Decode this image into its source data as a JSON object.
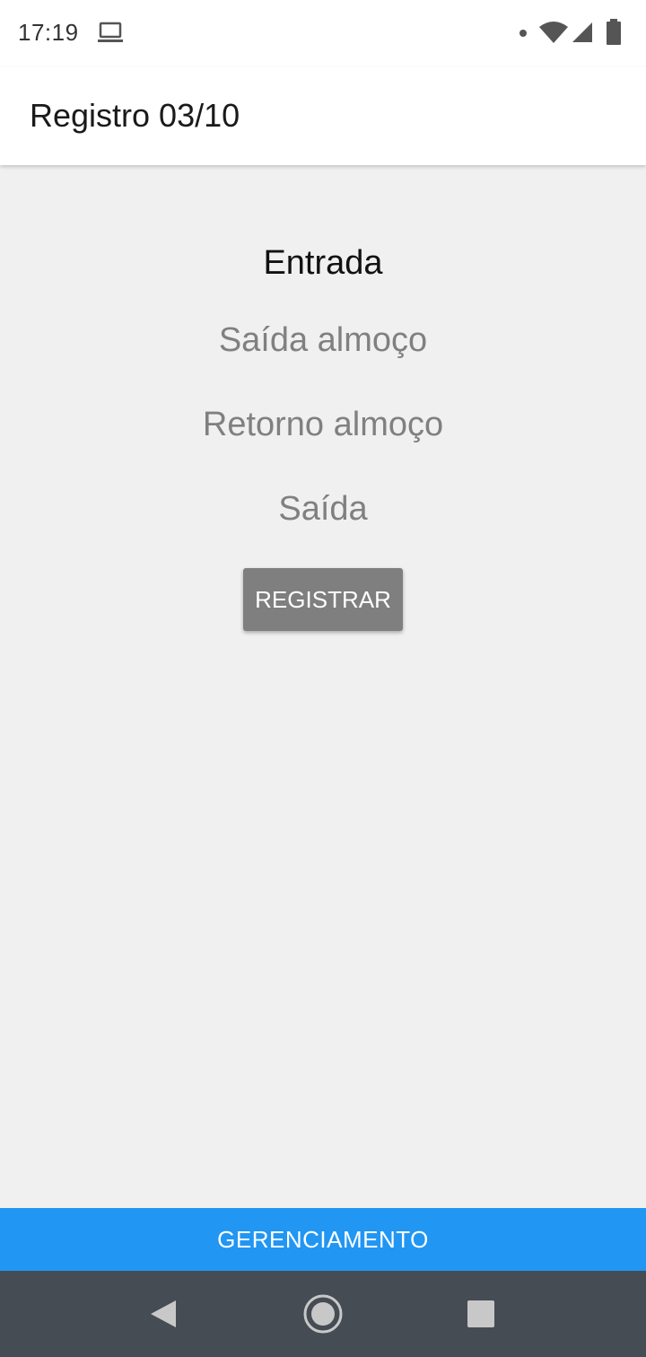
{
  "status_bar": {
    "time": "17:19",
    "icons": [
      "laptop-icon",
      "notification-dot-icon",
      "wifi-icon",
      "cell-signal-icon",
      "battery-icon"
    ]
  },
  "app_bar": {
    "title": "Registro 03/10"
  },
  "options": [
    {
      "label": "Entrada",
      "active": true
    },
    {
      "label": "Saída almoço",
      "active": false
    },
    {
      "label": "Retorno almoço",
      "active": false
    },
    {
      "label": "Saída",
      "active": false
    }
  ],
  "register_button": {
    "label": "REGISTRAR",
    "color": "#7f7f7f"
  },
  "manage_button": {
    "label": "GERENCIAMENTO",
    "color": "#2196f3"
  },
  "nav_bar": {
    "icons": [
      "back-icon",
      "home-icon",
      "recents-icon"
    ],
    "color": "#454c54"
  }
}
